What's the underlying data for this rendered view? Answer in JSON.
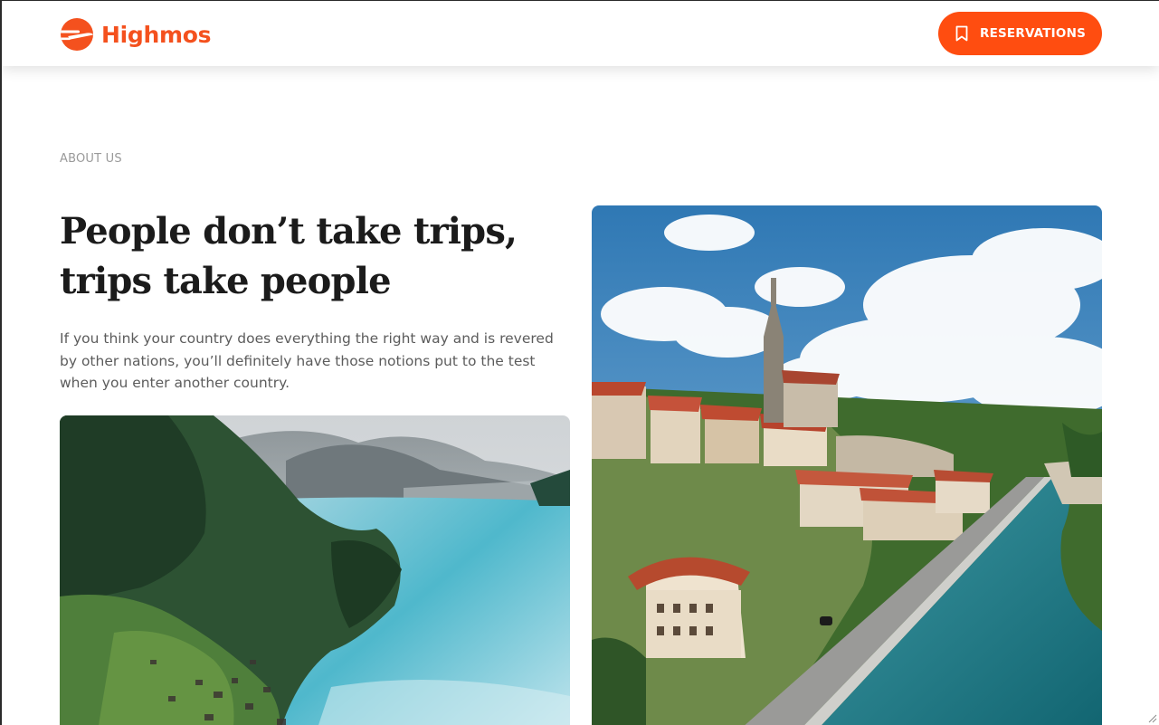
{
  "header": {
    "brand_name": "Highmos",
    "logo_icon": "plane-circle-icon",
    "reservations_label": "RESERVATIONS",
    "reservations_icon": "bookmark-icon"
  },
  "about": {
    "eyebrow": "ABOUT US",
    "headline": "People don’t take trips, trips take people",
    "body": "If you think your country does everything the right way and is revered by other nations, you’ll definitely have those notions put to the test when you enter another country."
  },
  "colors": {
    "accent": "#ff4d10",
    "brand": "#f4511e",
    "heading": "#1b1b1b",
    "body_text": "#5c5c5c",
    "eyebrow_text": "#9a9a9a"
  }
}
